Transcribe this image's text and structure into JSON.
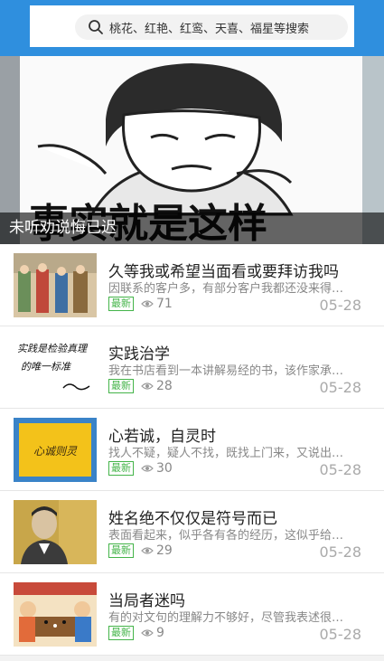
{
  "search": {
    "placeholder": "桃花、红艳、红鸾、天喜、福星等搜索"
  },
  "banner": {
    "image_text": "事实就是这样",
    "caption": "未听劝说悔已迟"
  },
  "articles": [
    {
      "title": "久等我或希望当面看或要拜访我吗",
      "excerpt": "因联系的客户多，有部分客户我都还没来得…",
      "badge": "最新",
      "views": "71",
      "date": "05-28"
    },
    {
      "title": "实践治学",
      "excerpt": "我在书店看到一本讲解易经的书，该作家承…",
      "badge": "最新",
      "views": "28",
      "date": "05-28",
      "thumb_text": [
        "实践是检验真理",
        "的唯一标准"
      ]
    },
    {
      "title": "心若诚，自灵时",
      "excerpt": "找人不疑，疑人不找，既找上门来，又说出…",
      "badge": "最新",
      "views": "30",
      "date": "05-28",
      "thumb_text": "心诚则灵"
    },
    {
      "title": "姓名绝不仅仅是符号而已",
      "excerpt": "表面看起来，似乎各有各的经历，这似乎给…",
      "badge": "最新",
      "views": "29",
      "date": "05-28"
    },
    {
      "title": "当局者迷吗",
      "excerpt": "有的对文句的理解力不够好，尽管我表述很…",
      "badge": "最新",
      "views": "9",
      "date": "05-28"
    }
  ]
}
